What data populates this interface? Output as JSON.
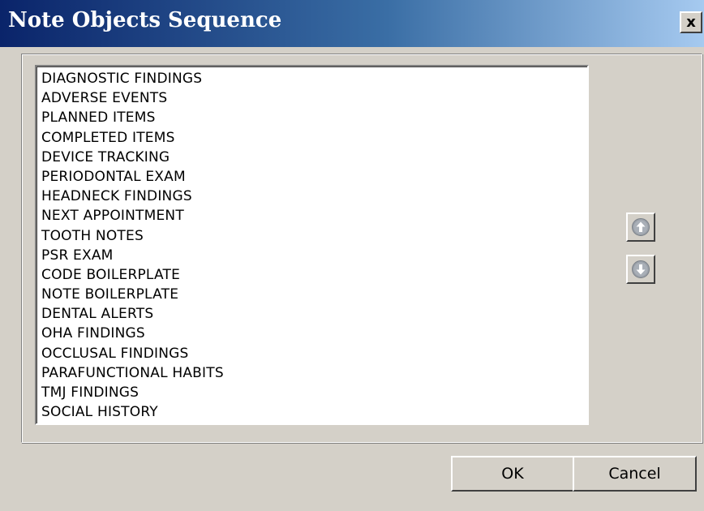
{
  "window": {
    "title": "Note Objects Sequence",
    "close_label": "x"
  },
  "list": {
    "items": [
      "DIAGNOSTIC FINDINGS",
      "ADVERSE EVENTS",
      "PLANNED ITEMS",
      "COMPLETED ITEMS",
      "DEVICE TRACKING",
      "PERIODONTAL EXAM",
      "HEADNECK FINDINGS",
      "NEXT APPOINTMENT",
      "TOOTH NOTES",
      "PSR EXAM",
      "CODE BOILERPLATE",
      "NOTE BOILERPLATE",
      "DENTAL ALERTS",
      "OHA FINDINGS",
      "OCCLUSAL FINDINGS",
      "PARAFUNCTIONAL HABITS",
      "TMJ FINDINGS",
      "SOCIAL HISTORY"
    ]
  },
  "buttons": {
    "move_up_icon": "arrow-up-circle-icon",
    "move_down_icon": "arrow-down-circle-icon",
    "ok_label": "OK",
    "cancel_label": "Cancel"
  },
  "colors": {
    "title_start": "#0a246a",
    "title_end": "#a6caf0",
    "face": "#d4d0c8",
    "icon_disabled": "#9aa0a8"
  }
}
